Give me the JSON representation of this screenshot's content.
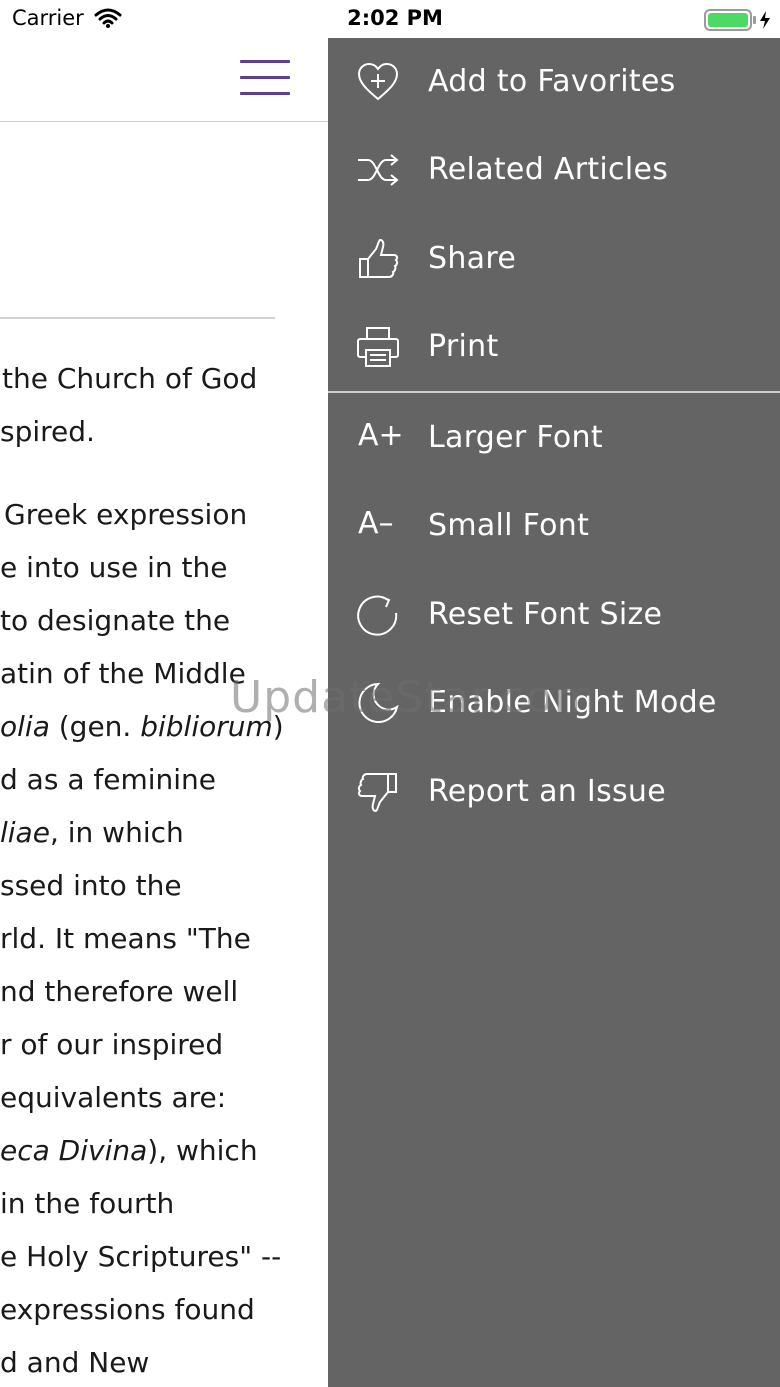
{
  "status_bar": {
    "carrier": "Carrier",
    "time": "2:02 PM"
  },
  "article": {
    "lines": [
      {
        "type": "plain",
        "text": "the Church of God"
      },
      {
        "type": "plain",
        "text": "spired."
      },
      {
        "type": "plain",
        "text": "Greek expression"
      },
      {
        "type": "plain",
        "text": "e into use in the"
      },
      {
        "type": "plain",
        "text": "to designate the"
      },
      {
        "type": "plain",
        "text": "atin of the Middle"
      },
      {
        "type": "plain",
        "text": "olia (gen. bibliorum)"
      },
      {
        "type": "plain",
        "text": "d as a feminine"
      },
      {
        "type": "plain",
        "text": "liae, in which"
      },
      {
        "type": "plain",
        "text": "ssed into the"
      },
      {
        "type": "plain",
        "text": "rld. It means \"The"
      },
      {
        "type": "plain",
        "text": "nd therefore well"
      },
      {
        "type": "plain",
        "text": "r of our inspired"
      },
      {
        "type": "plain",
        "text": "equivalents are:"
      },
      {
        "type": "plain",
        "text": "eca Divina), which"
      },
      {
        "type": "plain",
        "text": "in the fourth"
      },
      {
        "type": "plain",
        "text": "e Holy Scriptures\" --"
      },
      {
        "type": "plain",
        "text": "expressions found"
      },
      {
        "type": "plain",
        "text": "d and New"
      }
    ],
    "styled": {
      "line7": {
        "italic": "olia",
        "rest1": " (gen. ",
        "italic2": "bibliorum",
        "rest2": ")"
      },
      "line9": {
        "italic": "liae",
        "rest": ", in which"
      },
      "line15": {
        "italic": "eca Divina",
        "rest": "), which"
      }
    }
  },
  "menu": {
    "items": [
      {
        "label": "Add to Favorites",
        "icon": "heart-plus-icon"
      },
      {
        "label": "Related Articles",
        "icon": "shuffle-icon"
      },
      {
        "label": "Share",
        "icon": "thumbs-up-icon"
      },
      {
        "label": "Print",
        "icon": "printer-icon"
      },
      {
        "label": "Larger Font",
        "icon": "font-larger-icon",
        "glyph": "A+"
      },
      {
        "label": "Small Font",
        "icon": "font-smaller-icon",
        "glyph": "A–"
      },
      {
        "label": "Reset Font Size",
        "icon": "refresh-icon"
      },
      {
        "label": "Enable Night Mode",
        "icon": "moon-icon"
      },
      {
        "label": "Report an Issue",
        "icon": "thumbs-down-icon"
      }
    ]
  },
  "watermark": "UpdateStar.com",
  "colors": {
    "drawer_bg": "#646464",
    "accent": "#5b3f95",
    "battery": "#4cd964"
  }
}
